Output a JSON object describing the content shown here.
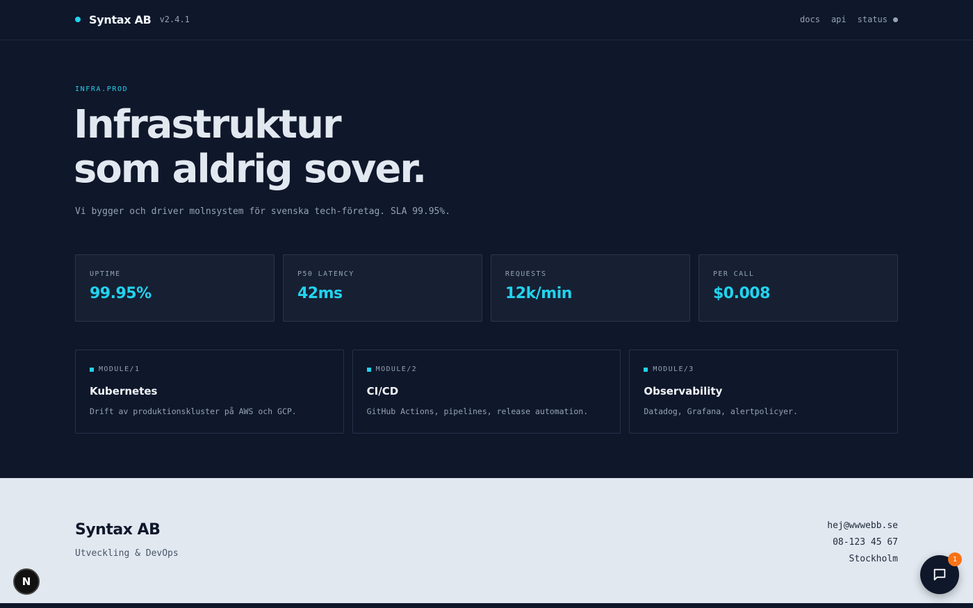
{
  "header": {
    "brand": "Syntax AB",
    "version": "v2.4.1",
    "nav": [
      "docs",
      "api",
      "status"
    ]
  },
  "hero": {
    "eyebrow": "INFRA.PROD",
    "title_line1": "Infrastruktur",
    "title_line2": "som aldrig sover.",
    "subtitle": "Vi bygger och driver molnsystem för svenska tech-företag. SLA 99.95%."
  },
  "stats": [
    {
      "label": "UPTIME",
      "value": "99.95%"
    },
    {
      "label": "P50 LATENCY",
      "value": "42ms"
    },
    {
      "label": "REQUESTS",
      "value": "12k/min"
    },
    {
      "label": "PER CALL",
      "value": "$0.008"
    }
  ],
  "modules": [
    {
      "tag": "MODULE/1",
      "title": "Kubernetes",
      "desc": "Drift av produktionskluster på AWS och GCP."
    },
    {
      "tag": "MODULE/2",
      "title": "CI/CD",
      "desc": "GitHub Actions, pipelines, release automation."
    },
    {
      "tag": "MODULE/3",
      "title": "Observability",
      "desc": "Datadog, Grafana, alertpolicyer."
    }
  ],
  "footer": {
    "name": "Syntax AB",
    "tagline": "Utveckling & DevOps",
    "email": "hej@wwwebb.se",
    "phone": "08-123 45 67",
    "city": "Stockholm"
  },
  "floating": {
    "n_badge": "N",
    "chat_count": "1",
    "chat_icon": "chat-bubble-icon"
  },
  "colors": {
    "accent": "#22d3ee",
    "background": "#0f172a",
    "footer_bg": "#e2e8f0",
    "notification": "#f97316"
  }
}
